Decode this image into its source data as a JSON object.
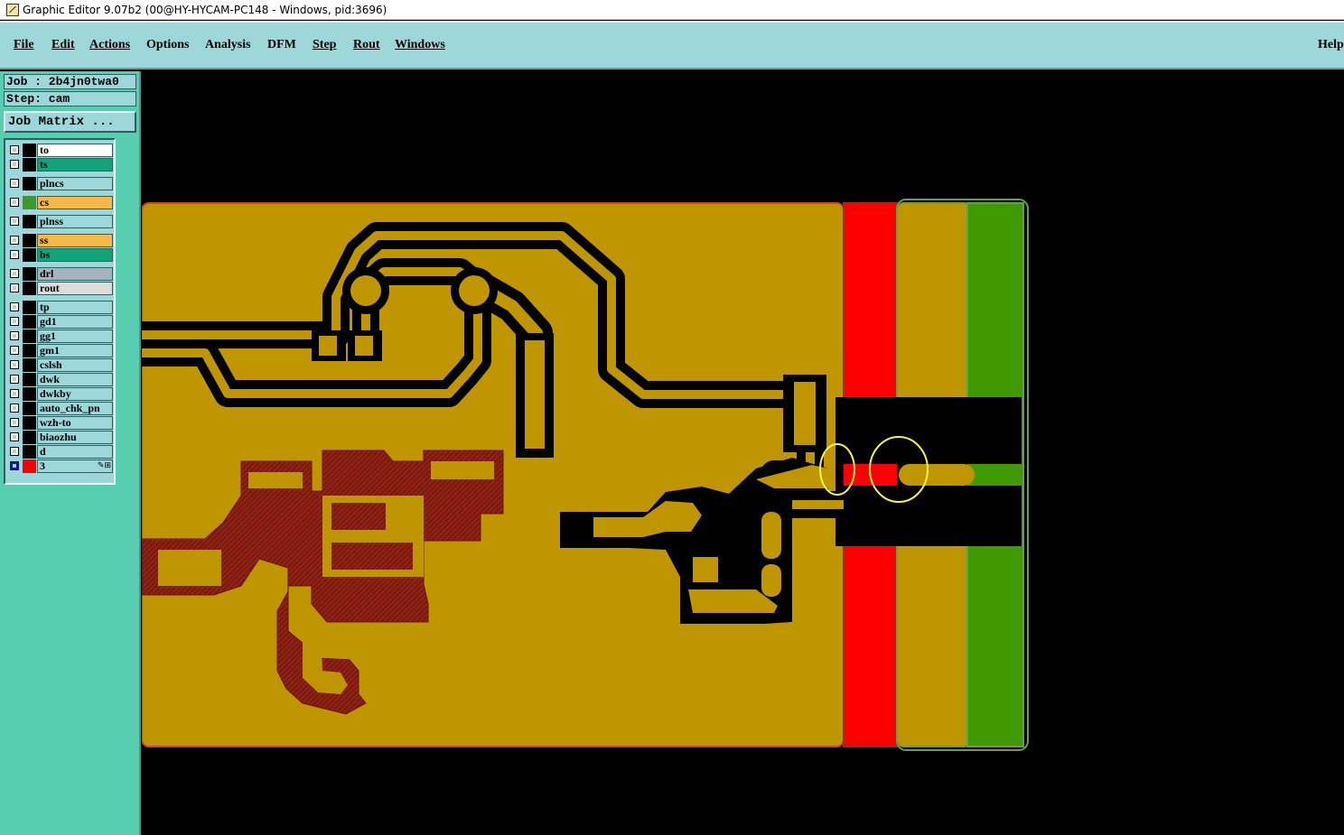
{
  "window": {
    "title": "Graphic Editor 9.07b2 (00@HY-HYCAM-PC148 - Windows, pid:3696)",
    "icon": "graphic-editor-app-icon"
  },
  "menu": {
    "items": [
      {
        "label": "File"
      },
      {
        "label": "Edit"
      },
      {
        "label": "Actions"
      },
      {
        "label": "Options"
      },
      {
        "label": "Analysis"
      },
      {
        "label": "DFM"
      },
      {
        "label": "Step"
      },
      {
        "label": "Rout"
      },
      {
        "label": "Windows"
      }
    ],
    "help": "Help"
  },
  "job": {
    "job_line": "Job : 2b4jn0twa0",
    "step_line": "Step: cam",
    "matrix_button": "Job Matrix ..."
  },
  "layers": [
    {
      "name": "to",
      "color": "#ffffff",
      "swatch": "#000000"
    },
    {
      "name": "ts",
      "color": "#12a37a",
      "swatch": "#000000"
    },
    {
      "name": "plncs",
      "color": "#9ed7da",
      "swatch": "#000000"
    },
    {
      "name": "cs",
      "color": "#f7b84a",
      "swatch": "#3d9a2a"
    },
    {
      "name": "plnss",
      "color": "#9ed7da",
      "swatch": "#000000"
    },
    {
      "name": "ss",
      "color": "#f7b84a",
      "swatch": "#000000"
    },
    {
      "name": "bs",
      "color": "#12a37a",
      "swatch": "#000000"
    },
    {
      "name": "drl",
      "color": "#a5b3bd",
      "swatch": "#000000"
    },
    {
      "name": "rout",
      "color": "#dcdcdc",
      "swatch": "#000000"
    },
    {
      "name": "tp",
      "color": "#9ed7da",
      "swatch": "#000000"
    },
    {
      "name": "gd1",
      "color": "#9ed7da",
      "swatch": "#000000"
    },
    {
      "name": "gg1",
      "color": "#9ed7da",
      "swatch": "#000000"
    },
    {
      "name": "gm1",
      "color": "#9ed7da",
      "swatch": "#000000"
    },
    {
      "name": "cslsh",
      "color": "#9ed7da",
      "swatch": "#000000"
    },
    {
      "name": "dwk",
      "color": "#9ed7da",
      "swatch": "#000000"
    },
    {
      "name": "dwkby",
      "color": "#9ed7da",
      "swatch": "#000000"
    },
    {
      "name": "auto_chk_pn",
      "color": "#9ed7da",
      "swatch": "#000000"
    },
    {
      "name": "wzh-to",
      "color": "#9ed7da",
      "swatch": "#000000"
    },
    {
      "name": "biaozhu",
      "color": "#9ed7da",
      "swatch": "#000000"
    },
    {
      "name": "d",
      "color": "#9ed7da",
      "swatch": "#000000"
    },
    {
      "name": "3",
      "color": "#9ed7da",
      "swatch": "#ff0000",
      "box_color": "#0a1a8a",
      "tool_icon": "edit-tool-icon"
    }
  ],
  "colors": {
    "copper": "#bf9600",
    "dark_pattern": "#8e1c12",
    "red_band": "#ff0000",
    "green_band": "#3f9a00",
    "highlight_circle": "#f4f442",
    "background": "#000000"
  }
}
